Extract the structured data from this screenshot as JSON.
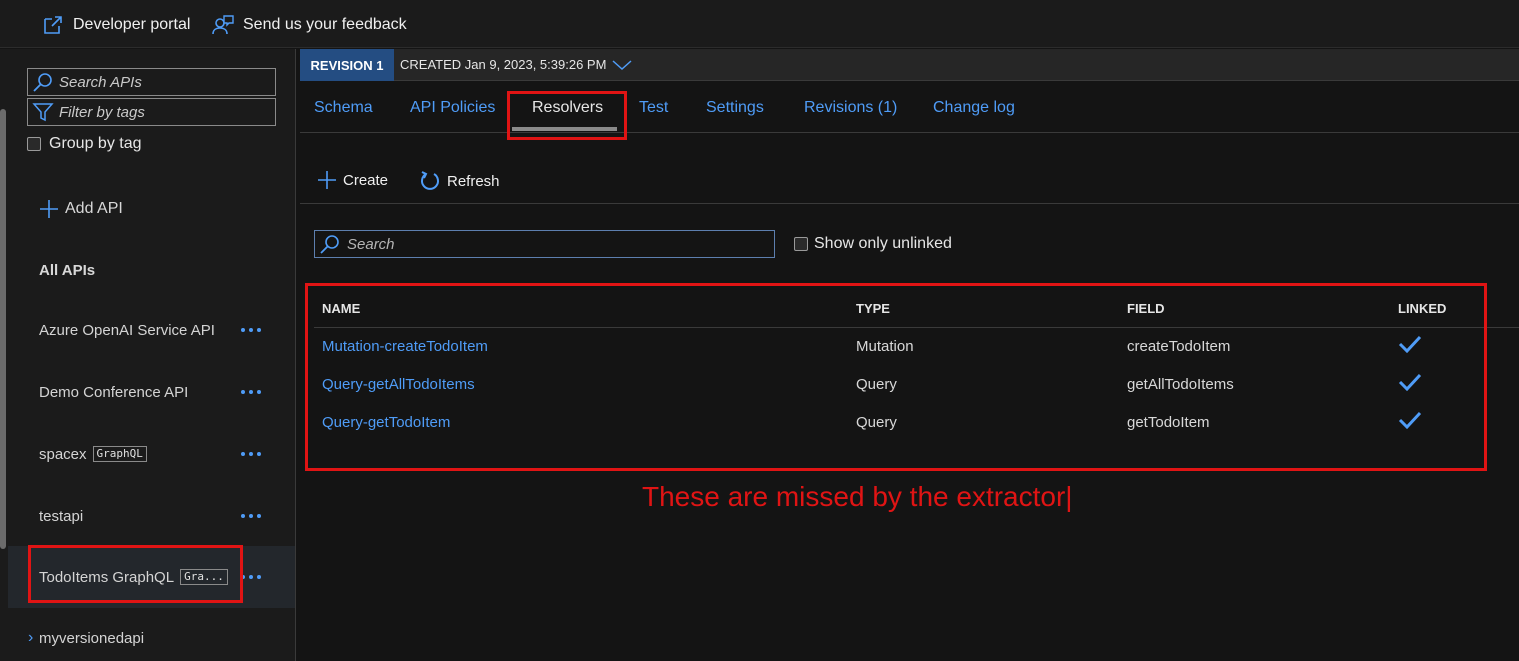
{
  "topbar": {
    "developer_portal": "Developer portal",
    "feedback": "Send us your feedback"
  },
  "sidebar": {
    "search_placeholder": "Search APIs",
    "filter_placeholder": "Filter by tags",
    "group_by_tag": "Group by tag",
    "add_api": "Add API",
    "all_apis": "All APIs",
    "apis": [
      {
        "name": "Azure OpenAI Service API",
        "badge": ""
      },
      {
        "name": "Demo Conference API",
        "badge": ""
      },
      {
        "name": "spacex",
        "badge": "GraphQL"
      },
      {
        "name": "testapi",
        "badge": ""
      },
      {
        "name": "TodoItems GraphQL",
        "badge": "Gra..."
      },
      {
        "name": "myversionedapi",
        "badge": ""
      }
    ],
    "selected": "TodoItems GraphQL"
  },
  "revision": {
    "tag": "REVISION 1",
    "created": "CREATED Jan 9, 2023, 5:39:26 PM"
  },
  "tabs": [
    "Schema",
    "API Policies",
    "Resolvers",
    "Test",
    "Settings",
    "Revisions (1)",
    "Change log"
  ],
  "active_tab": "Resolvers",
  "toolbar": {
    "create": "Create",
    "refresh": "Refresh"
  },
  "search": {
    "placeholder": "Search"
  },
  "show_only_unlinked": "Show only unlinked",
  "table": {
    "headers": [
      "NAME",
      "TYPE",
      "FIELD",
      "LINKED"
    ],
    "rows": [
      {
        "name": "Mutation-createTodoItem",
        "type": "Mutation",
        "field": "createTodoItem",
        "linked": true
      },
      {
        "name": "Query-getAllTodoItems",
        "type": "Query",
        "field": "getAllTodoItems",
        "linked": true
      },
      {
        "name": "Query-getTodoItem",
        "type": "Query",
        "field": "getTodoItem",
        "linked": true
      }
    ]
  },
  "annotation": "These are missed by the extractor|",
  "colors": {
    "accent": "#4f9cf7",
    "highlight": "#e01414",
    "revision_tag": "#244d82"
  }
}
